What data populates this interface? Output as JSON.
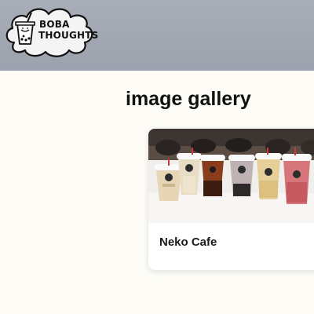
{
  "header": {
    "logo": {
      "icon": "boba-cup-cloud-logo",
      "line1": "BOBA",
      "line2": "THOUGHTS"
    }
  },
  "main": {
    "title": "image gallery",
    "gallery": [
      {
        "caption": "Neko Cafe",
        "image_icon": "boba-drinks-photo"
      }
    ]
  },
  "colors": {
    "header_bg": "#9ca2ad",
    "page_bg": "#fdfcf7",
    "card_bg": "#ffffff"
  }
}
